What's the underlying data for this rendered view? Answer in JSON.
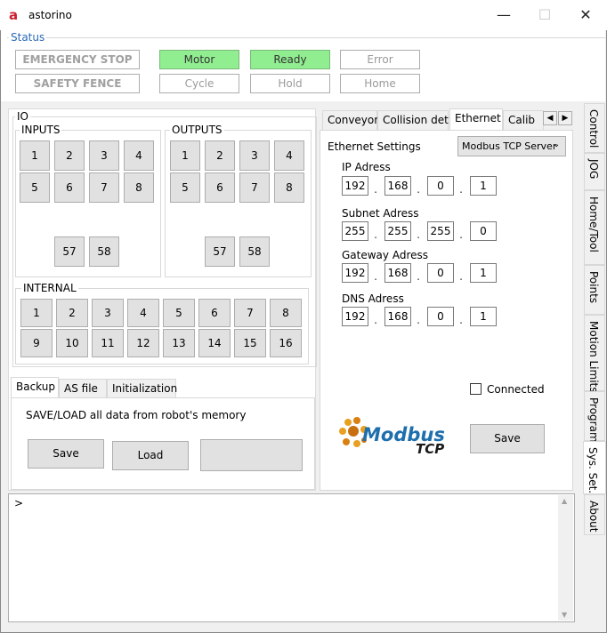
{
  "window": {
    "title": "astorino",
    "logo_text": "a"
  },
  "titlebar_buttons": {
    "minimize": "—",
    "maximize": "☐",
    "close": "✕"
  },
  "status": {
    "label": "Status",
    "emergency_stop": "EMERGENCY STOP",
    "safety_fence": "SAFETY FENCE",
    "motor": "Motor",
    "ready": "Ready",
    "error": "Error",
    "cycle": "Cycle",
    "hold": "Hold",
    "home": "Home"
  },
  "io": {
    "title": "IO",
    "inputs_label": "INPUTS",
    "outputs_label": "OUTPUTS",
    "internal_label": "INTERNAL",
    "inputs": [
      "1",
      "2",
      "3",
      "4",
      "5",
      "6",
      "7",
      "8"
    ],
    "inputs_extra": [
      "57",
      "58"
    ],
    "outputs": [
      "1",
      "2",
      "3",
      "4",
      "5",
      "6",
      "7",
      "8"
    ],
    "outputs_extra": [
      "57",
      "58"
    ],
    "internal": [
      "1",
      "2",
      "3",
      "4",
      "5",
      "6",
      "7",
      "8",
      "9",
      "10",
      "11",
      "12",
      "13",
      "14",
      "15",
      "16"
    ]
  },
  "backup": {
    "tabs": [
      "Backup",
      "AS file",
      "Initialization"
    ],
    "description": "SAVE/LOAD all data from robot's memory",
    "save": "Save",
    "load": "Load"
  },
  "settings_tabs": [
    "Conveyor",
    "Collision det.",
    "Ethernet",
    "Calib"
  ],
  "ethernet": {
    "settings_label": "Ethernet Settings",
    "mode_selected": "Modbus TCP Server",
    "ip_label": "IP Adress",
    "ip": [
      "192",
      "168",
      "0",
      "1"
    ],
    "subnet_label": "Subnet Adress",
    "subnet": [
      "255",
      "255",
      "255",
      "0"
    ],
    "gateway_label": "Gateway Adress",
    "gateway": [
      "192",
      "168",
      "0",
      "1"
    ],
    "dns_label": "DNS Adress",
    "dns": [
      "192",
      "168",
      "0",
      "1"
    ],
    "connected_label": "Connected",
    "connected": false,
    "save": "Save",
    "modbus_logo_top": "Modbus",
    "modbus_logo_bottom": "TCP"
  },
  "console": {
    "prompt": ">"
  },
  "side_tabs": [
    "Control",
    "JOG",
    "Home/Tool",
    "Points",
    "Motion Limits",
    "Program",
    "Sys. Set.",
    "About"
  ],
  "colors": {
    "green": "#90ee90",
    "accent": "#2a6ab8",
    "logo_red": "#cc1f2f"
  }
}
